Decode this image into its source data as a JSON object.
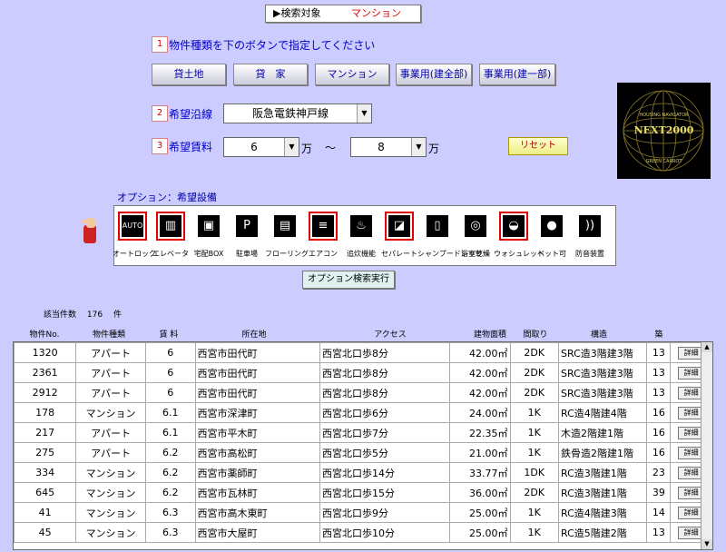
{
  "search_target": {
    "label": "▶検索対象",
    "value": "マンション"
  },
  "step1": {
    "num": "1",
    "text": "物件種類を下のボタンで指定してください"
  },
  "type_buttons": [
    "貸土地",
    "貸　家",
    "マンション",
    "事業用(建全部)",
    "事業用(建一部)"
  ],
  "step2": {
    "num": "2",
    "label": "希望沿線",
    "value": "阪急電鉄神戸線"
  },
  "step3": {
    "num": "3",
    "label": "希望賃料",
    "min": "6",
    "max": "8",
    "unit": "万",
    "tilde": "～"
  },
  "reset_label": "リセット",
  "logo": {
    "top": "HOUSING NAVIGATOR",
    "main": "NEXT2000",
    "bottom": "GREEN CARROT"
  },
  "options_title": "オプション：希望設備",
  "options": [
    {
      "icon": "auto-lock-icon",
      "label": "オートロック",
      "on": true
    },
    {
      "icon": "elevator-icon",
      "label": "エレベータ",
      "on": true
    },
    {
      "icon": "delivery-box-icon",
      "label": "宅配BOX",
      "on": false
    },
    {
      "icon": "parking-icon",
      "label": "駐車場",
      "on": false
    },
    {
      "icon": "flooring-icon",
      "label": "フローリング",
      "on": false
    },
    {
      "icon": "aircon-icon",
      "label": "エアコン",
      "on": true
    },
    {
      "icon": "reheating-icon",
      "label": "追炊機能",
      "on": false
    },
    {
      "icon": "separate-bath-icon",
      "label": "セパレート",
      "on": true
    },
    {
      "icon": "shampoo-dresser-icon",
      "label": "シャンプードレッサー",
      "on": false
    },
    {
      "icon": "bath-dryer-icon",
      "label": "浴室乾燥",
      "on": false
    },
    {
      "icon": "washlet-icon",
      "label": "ウォシュレット",
      "on": true
    },
    {
      "icon": "pet-icon",
      "label": "ペット可",
      "on": false
    },
    {
      "icon": "soundproof-icon",
      "label": "防音装置",
      "on": false
    }
  ],
  "option_exec_label": "オプション検索実行",
  "result_count": {
    "label": "該当件数",
    "value": "176",
    "unit": "件"
  },
  "columns": [
    "物件No.",
    "物件種類",
    "賃 料",
    "所在地",
    "アクセス",
    "建物面積",
    "間取り",
    "構造",
    "築"
  ],
  "detail_label": "詳細",
  "rows": [
    [
      "1320",
      "アパート",
      "6",
      "西宮市田代町",
      "西宮北口歩8分",
      "42.00㎡",
      "2DK",
      "SRC造3階建3階",
      "13"
    ],
    [
      "2361",
      "アパート",
      "6",
      "西宮市田代町",
      "西宮北口歩8分",
      "42.00㎡",
      "2DK",
      "SRC造3階建3階",
      "13"
    ],
    [
      "2912",
      "アパート",
      "6",
      "西宮市田代町",
      "西宮北口歩8分",
      "42.00㎡",
      "2DK",
      "SRC造3階建3階",
      "13"
    ],
    [
      "178",
      "マンション",
      "6.1",
      "西宮市深津町",
      "西宮北口歩6分",
      "24.00㎡",
      "1K",
      "RC造4階建4階",
      "16"
    ],
    [
      "217",
      "アパート",
      "6.1",
      "西宮市平木町",
      "西宮北口歩7分",
      "22.35㎡",
      "1K",
      "木造2階建1階",
      "16"
    ],
    [
      "275",
      "アパート",
      "6.2",
      "西宮市高松町",
      "西宮北口歩5分",
      "21.00㎡",
      "1K",
      "鉄骨造2階建1階",
      "16"
    ],
    [
      "334",
      "マンション",
      "6.2",
      "西宮市薬師町",
      "西宮北口歩14分",
      "33.77㎡",
      "1DK",
      "RC造3階建1階",
      "23"
    ],
    [
      "645",
      "マンション",
      "6.2",
      "西宮市瓦林町",
      "西宮北口歩15分",
      "36.00㎡",
      "2DK",
      "RC造3階建1階",
      "39"
    ],
    [
      "41",
      "マンション",
      "6.3",
      "西宮市高木東町",
      "西宮北口歩9分",
      "25.00㎡",
      "1K",
      "RC造4階建3階",
      "14"
    ],
    [
      "45",
      "マンション",
      "6.3",
      "西宮市大屋町",
      "西宮北口歩10分",
      "25.00㎡",
      "1K",
      "RC造5階建2階",
      "13"
    ]
  ]
}
